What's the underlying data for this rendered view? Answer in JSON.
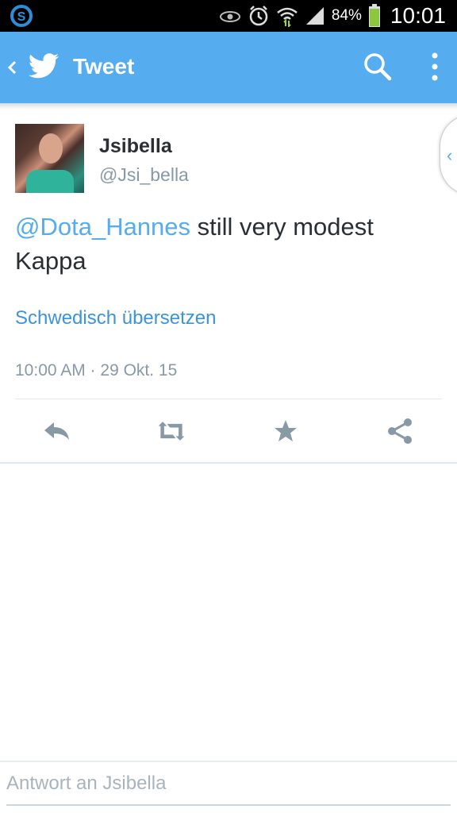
{
  "status_bar": {
    "battery_percent": "84%",
    "time": "10:01",
    "icons": [
      "skype-icon",
      "eye-icon",
      "alarm-icon",
      "wifi-icon",
      "signal-icon",
      "battery-icon"
    ]
  },
  "action_bar": {
    "title": "Tweet",
    "icons": [
      "back-icon",
      "twitter-bird-icon",
      "search-icon",
      "more-icon"
    ],
    "color": "#55acee"
  },
  "tweet": {
    "display_name": "Jsibella",
    "handle": "@Jsi_bella",
    "mention": "@Dota_Hannes",
    "text": " still very modest Kappa",
    "translate_label": "Schwedisch übersetzen",
    "timestamp": "10:00 AM · 29 Okt. 15",
    "actions": [
      "reply-icon",
      "retweet-icon",
      "favorite-icon",
      "share-icon"
    ]
  },
  "reply": {
    "placeholder": "Antwort an Jsibella"
  }
}
